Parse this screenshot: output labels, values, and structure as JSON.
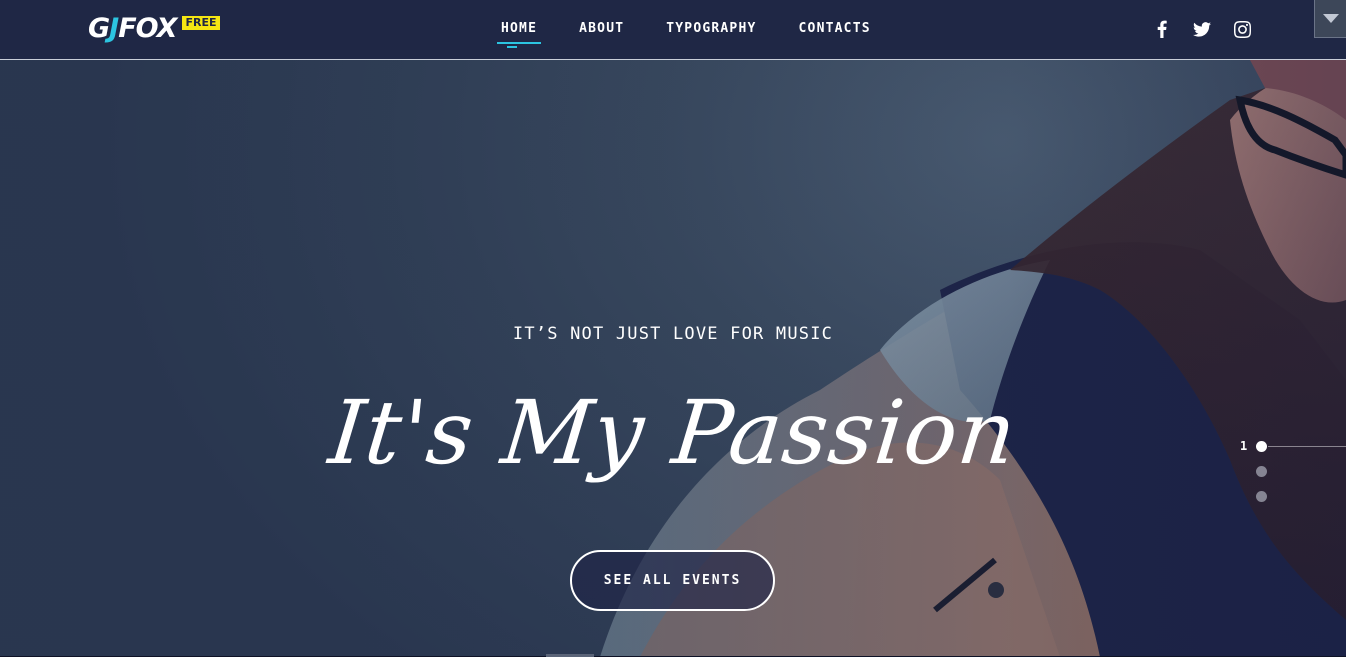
{
  "header": {
    "logo": {
      "mark_letters": "GJ",
      "mark_word": "FOX",
      "badge": "FREE"
    },
    "nav": [
      {
        "label": "HOME",
        "active": true
      },
      {
        "label": "ABOUT",
        "active": false
      },
      {
        "label": "TYPOGRAPHY",
        "active": false
      },
      {
        "label": "CONTACTS",
        "active": false
      }
    ],
    "social": [
      "facebook-icon",
      "twitter-icon",
      "instagram-icon"
    ],
    "dropdown_icon": "chevron-down-icon"
  },
  "hero": {
    "subtitle": "IT’S NOT JUST LOVE FOR MUSIC",
    "title": "It's My Passion",
    "cta_label": "SEE ALL EVENTS",
    "slider": {
      "current_label": "1",
      "slide_count": 3,
      "active_index": 0
    }
  },
  "colors": {
    "header_bg": "#1f2745",
    "accent": "#2cc4e0",
    "badge": "#f5e612",
    "text": "#ffffff"
  }
}
